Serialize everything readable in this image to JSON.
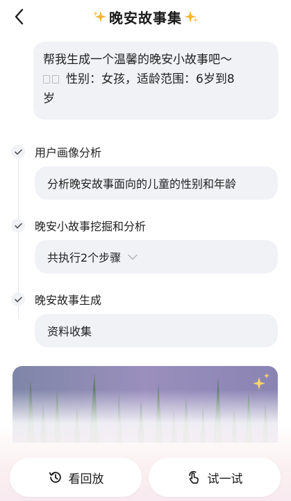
{
  "header": {
    "title": "晚安故事集",
    "back_icon": "chevron-left-icon",
    "accent_color": "#f7b531"
  },
  "user_message": {
    "line1": "帮我生成一个温馨的晚安小故事吧～",
    "line2": "性别：女孩，适龄范围：6岁到8",
    "line3": "岁"
  },
  "steps": [
    {
      "title": "用户画像分析",
      "detail": "分析晚安故事面向的儿童的性别和年龄"
    },
    {
      "title": "晚安小故事挖掘和分析",
      "detail": "共执行2个步骤"
    },
    {
      "title": "晚安故事生成",
      "detail": "资料收集"
    }
  ],
  "footer": {
    "replay_label": "看回放",
    "try_label": "试一试"
  }
}
